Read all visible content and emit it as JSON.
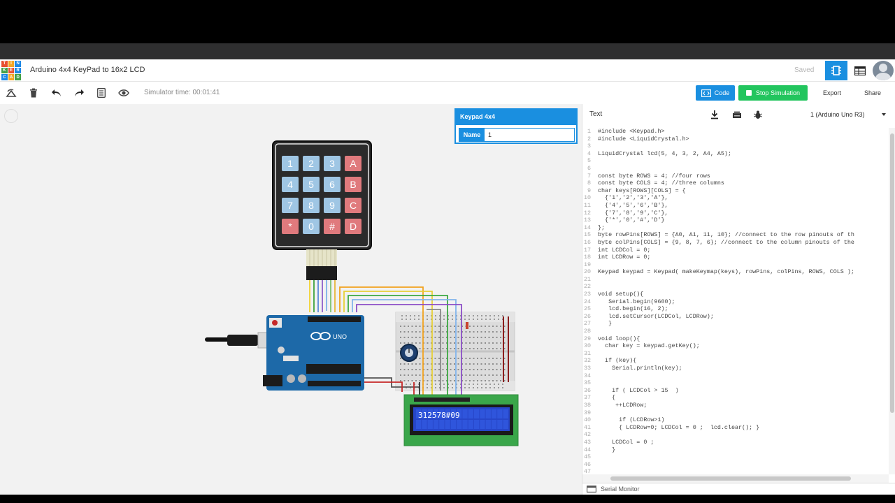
{
  "header": {
    "logo_letters": [
      "TIN",
      "KER",
      "CAD"
    ],
    "project_title": "Arduino 4x4 KeyPad to 16x2 LCD",
    "saved_label": "Saved"
  },
  "toolbar": {
    "simulator_time": "Simulator time: 00:01:41",
    "code_label": "Code",
    "stop_simulation_label": "Stop Simulation",
    "export_label": "Export",
    "share_label": "Share"
  },
  "inspector": {
    "title": "Keypad 4x4",
    "name_label": "Name",
    "name_value": "1"
  },
  "circuit": {
    "keypad_keys": [
      "1",
      "2",
      "3",
      "A",
      "4",
      "5",
      "6",
      "B",
      "7",
      "8",
      "9",
      "C",
      "*",
      "0",
      "#",
      "D"
    ],
    "lcd_text": "312578#09",
    "arduino_label": "UNO"
  },
  "code_panel": {
    "mode_label": "Text",
    "device_select": "1 (Arduino Uno R3)",
    "lines": [
      "#include <Keypad.h>",
      "#include <LiquidCrystal.h>",
      "",
      "LiquidCrystal lcd(5, 4, 3, 2, A4, A5);",
      "",
      "",
      "const byte ROWS = 4; //four rows",
      "const byte COLS = 4; //three columns",
      "char keys[ROWS][COLS] = {",
      "  {'1','2','3','A'},",
      "  {'4','5','6','B'},",
      "  {'7','8','9','C'},",
      "  {'*','0','#','D'}",
      "};",
      "byte rowPins[ROWS] = {A0, A1, 11, 10}; //connect to the row pinouts of th",
      "byte colPins[COLS] = {9, 8, 7, 6}; //connect to the column pinouts of the",
      "int LCDCol = 0;",
      "int LCDRow = 0;",
      "",
      "Keypad keypad = Keypad( makeKeymap(keys), rowPins, colPins, ROWS, COLS );",
      "",
      "",
      "void setup(){",
      "   Serial.begin(9600);",
      "   lcd.begin(16, 2);",
      "   lcd.setCursor(LCDCol, LCDRow);",
      "   }",
      "",
      "void loop(){",
      "  char key = keypad.getKey();",
      "",
      "  if (key){",
      "    Serial.println(key);",
      "",
      "",
      "    if ( LCDCol > 15  )",
      "    {",
      "     ++LCDRow;",
      "",
      "      if (LCDRow>1)",
      "      { LCDRow=0; LCDCol = 0 ;  lcd.clear(); }",
      "",
      "    LCDCol = 0 ;",
      "    }",
      "",
      "",
      ""
    ],
    "serial_monitor_label": "Serial Monitor"
  },
  "colors": {
    "accent": "#1a8fe0",
    "stop_green": "#22c55e",
    "keypad_blue": "#9fc6e4",
    "keypad_red": "#e07a7d",
    "arduino_blue": "#1d69a8",
    "lcd_green": "#3aa64a",
    "lcd_screen": "#2746c9"
  }
}
